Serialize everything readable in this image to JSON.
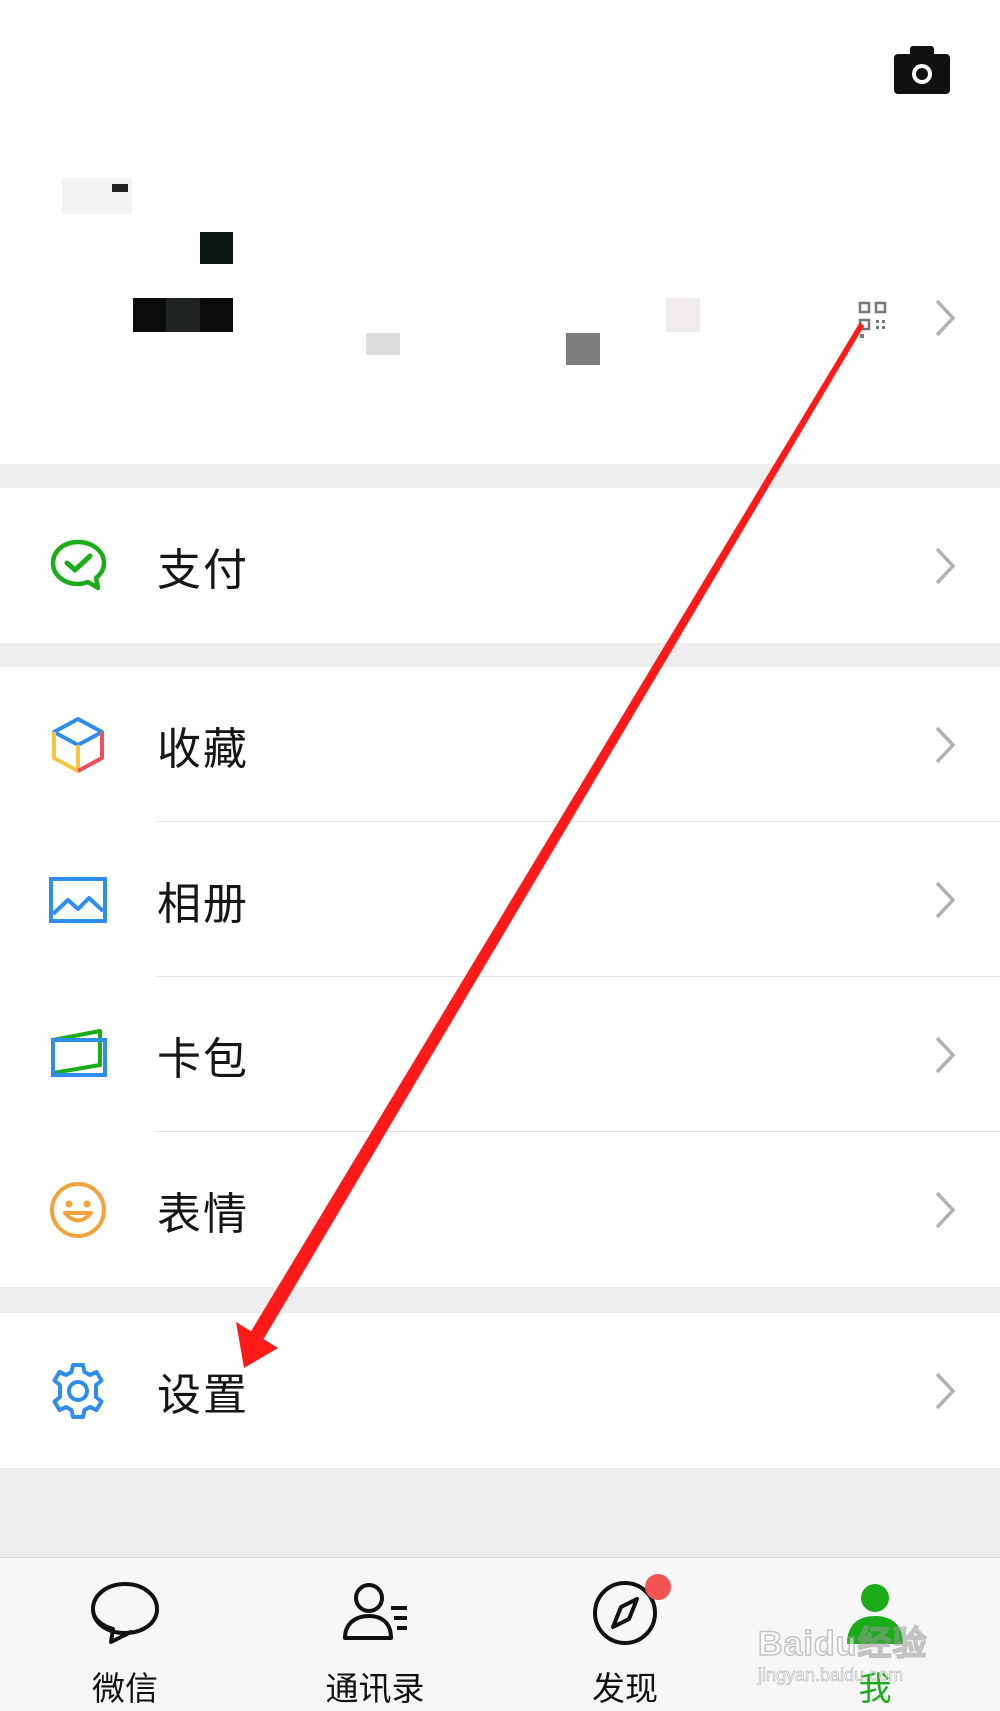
{
  "app": {
    "accent_color": "#1aad19"
  },
  "profile": {
    "camera_icon": "camera-icon",
    "qr_icon": "qrcode-icon"
  },
  "menu": {
    "pay": {
      "label": "支付",
      "icon": "wechat-pay-icon"
    },
    "favorites": {
      "label": "收藏",
      "icon": "cube-icon"
    },
    "album": {
      "label": "相册",
      "icon": "image-icon"
    },
    "cards": {
      "label": "卡包",
      "icon": "wallet-icon"
    },
    "stickers": {
      "label": "表情",
      "icon": "smiley-icon"
    },
    "settings": {
      "label": "设置",
      "icon": "gear-icon"
    }
  },
  "tabbar": {
    "tabs": [
      {
        "label": "微信",
        "icon": "chat-bubble-icon"
      },
      {
        "label": "通讯录",
        "icon": "contacts-icon"
      },
      {
        "label": "发现",
        "icon": "compass-icon"
      },
      {
        "label": "我",
        "icon": "person-icon",
        "active": true
      }
    ]
  },
  "watermark": {
    "main": "Baidu经验",
    "sub": "jingyan.baidu.com"
  }
}
